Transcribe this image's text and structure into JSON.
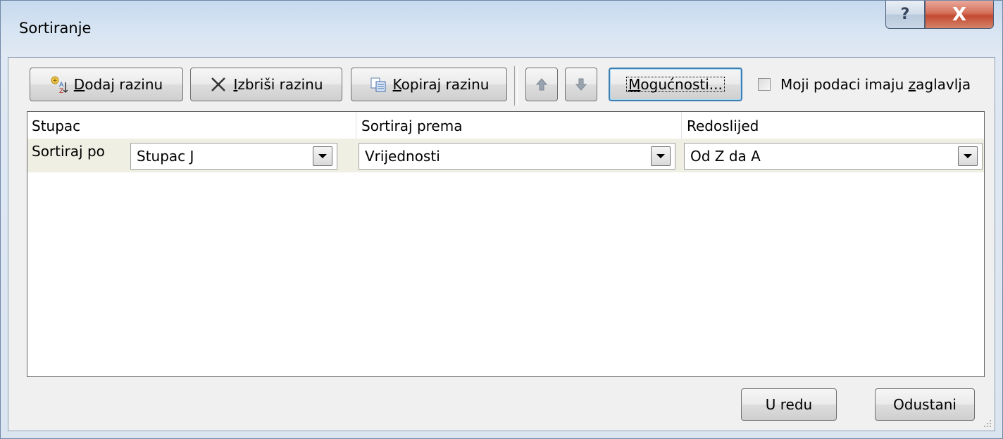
{
  "window": {
    "title": "Sortiranje",
    "help_glyph": "?",
    "close_glyph": "X"
  },
  "toolbar": {
    "add_level": {
      "accel": "D",
      "rest": "odaj razinu",
      "icon": "add-sort-level-icon"
    },
    "delete_level": {
      "accel": "I",
      "rest": "zbriši razinu",
      "icon": "delete-x-icon"
    },
    "copy_level": {
      "accel": "K",
      "rest": "opiraj razinu",
      "icon": "copy-icon"
    },
    "move_up_icon": "arrow-up-icon",
    "move_down_icon": "arrow-down-icon",
    "options": {
      "accel": "M",
      "rest": "ogućnosti..."
    },
    "headers_checkbox": {
      "pre": "Moji podaci imaju ",
      "accel": "z",
      "post": "aglavlja",
      "checked": false
    }
  },
  "grid": {
    "headers": [
      "Stupac",
      "Sortiraj prema",
      "Redoslijed"
    ],
    "rows": [
      {
        "label": "Sortiraj po",
        "column": "Stupac J",
        "sort_on": "Vrijednosti",
        "order": "Od Z da A"
      }
    ]
  },
  "footer": {
    "ok": "U redu",
    "cancel": "Odustani"
  },
  "colors": {
    "row_highlight": "#f0efe4",
    "close_button": "#c24a30",
    "focus_border": "#3c7fb1"
  }
}
